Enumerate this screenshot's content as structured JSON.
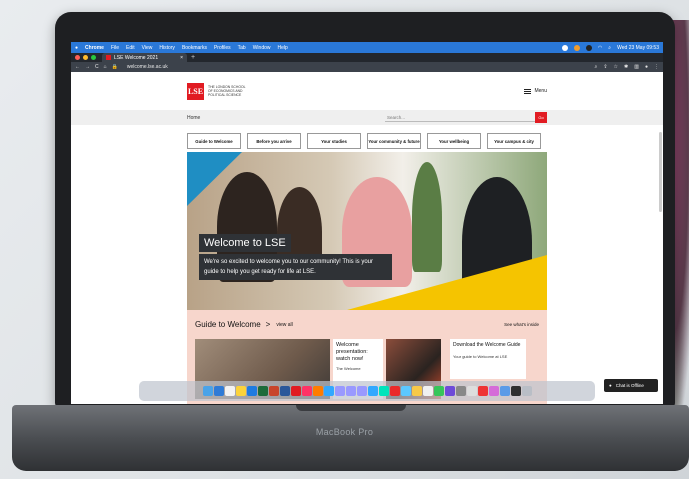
{
  "device": {
    "brand": "MacBook Pro"
  },
  "mac_menu": {
    "apple": "",
    "app": "Chrome",
    "items": [
      "File",
      "Edit",
      "View",
      "History",
      "Bookmarks",
      "Profiles",
      "Tab",
      "Window",
      "Help"
    ],
    "clock": "Wed 23 May  09:53"
  },
  "browser": {
    "tab_title": "LSE Welcome 2021",
    "close": "×",
    "new_tab": "+",
    "url": "welcome.lse.ac.uk",
    "back": "←",
    "forward": "→",
    "reload": "C",
    "home": "⌂"
  },
  "site": {
    "logo": "LSE",
    "logo_name": [
      "THE LONDON SCHOOL",
      "OF ECONOMICS AND",
      "POLITICAL SCIENCE"
    ],
    "menu_label": "Menu",
    "breadcrumb": "Home",
    "search_placeholder": "Search...",
    "search_button": "Go",
    "nav": [
      "Guide to Welcome",
      "Before you arrive",
      "Your studies",
      "Your community & future",
      "Your wellbeing",
      "Your campus & city"
    ],
    "hero_title": "Welcome to LSE",
    "hero_text": "We're so excited to welcome you to our community! This is your guide to help you get ready for life at LSE.",
    "guide": {
      "title": "Guide to Welcome",
      "arrow": ">",
      "view_all": "view all",
      "see_inside": "See what's inside",
      "card1_title": "Welcome presentation: watch now!",
      "card1_sub": "The Welcome",
      "card2_title": "Download the Welcome Guide",
      "card2_sub": "Your guide to Welcome at LSE"
    },
    "chat": "Chat is Offline"
  },
  "colors": {
    "lse_red": "#e11b22",
    "guide_bg": "#f7d6cc",
    "mac_bar": "#2a78d8"
  }
}
